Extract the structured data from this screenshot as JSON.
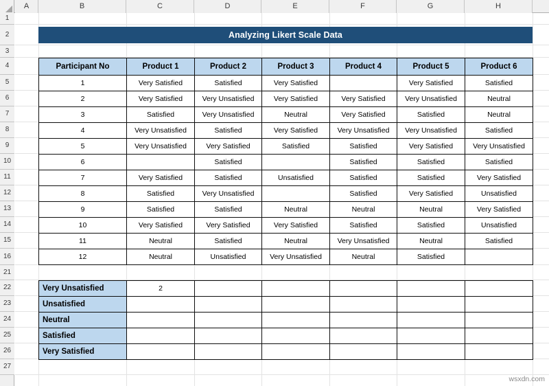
{
  "app": {
    "type": "spreadsheet",
    "watermark": "wsxdn.com"
  },
  "colors": {
    "title_banner_bg": "#1F4E79",
    "title_banner_text": "#FFFFFF",
    "header_bg": "#BDD7EE",
    "label_bg": "#BDD7EE",
    "cell_border": "#0D0D0D",
    "gridline": "#E3E3E3",
    "sheet_chrome": "#F0F0F0"
  },
  "column_headers": [
    "A",
    "B",
    "C",
    "D",
    "E",
    "F",
    "G",
    "H"
  ],
  "row_headers": [
    "1",
    "2",
    "3",
    "4",
    "5",
    "6",
    "7",
    "8",
    "9",
    "10",
    "11",
    "12",
    "13",
    "14",
    "15",
    "16",
    "21",
    "22",
    "23",
    "24",
    "25",
    "26",
    "27"
  ],
  "title": {
    "text": "Analyzing Likert Scale Data"
  },
  "main_table": {
    "headers": [
      "Participant No",
      "Product 1",
      "Product 2",
      "Product 3",
      "Product 4",
      "Product 5",
      "Product 6"
    ],
    "rows": [
      [
        "1",
        "Very Satisfied",
        "Satisfied",
        "Very Satisfied",
        "",
        "Very Satisfied",
        "Satisfied"
      ],
      [
        "2",
        "Very Satisfied",
        "Very Unsatisfied",
        "Very Satisfied",
        "Very Satisfied",
        "Very Unsatisfied",
        "Neutral"
      ],
      [
        "3",
        "Satisfied",
        "Very Unsatisfied",
        "Neutral",
        "Very Satisfied",
        "Satisfied",
        "Neutral"
      ],
      [
        "4",
        "Very Unsatisfied",
        "Satisfied",
        "Very Satisfied",
        "Very Unsatisfied",
        "Very Unsatisfied",
        "Satisfied"
      ],
      [
        "5",
        "Very Unsatisfied",
        "Very Satisfied",
        "Satisfied",
        "Satisfied",
        "Very Satisfied",
        "Very Unsatisfied"
      ],
      [
        "6",
        "",
        "Satisfied",
        "",
        "Satisfied",
        "Satisfied",
        "Satisfied"
      ],
      [
        "7",
        "Very Satisfied",
        "Satisfied",
        "Unsatisfied",
        "Satisfied",
        "Satisfied",
        "Very Satisfied"
      ],
      [
        "8",
        "Satisfied",
        "Very Unsatisfied",
        "",
        "Satisfied",
        "Very Satisfied",
        "Unsatisfied"
      ],
      [
        "9",
        "Satisfied",
        "Satisfied",
        "Neutral",
        "Neutral",
        "Neutral",
        "Very Satisfied"
      ],
      [
        "10",
        "Very Satisfied",
        "Very Satisfied",
        "Very Satisfied",
        "Satisfied",
        "Satisfied",
        "Unsatisfied"
      ],
      [
        "11",
        "Neutral",
        "Satisfied",
        "Neutral",
        "Very Unsatisfied",
        "Neutral",
        "Satisfied"
      ],
      [
        "12",
        "Neutral",
        "Unsatisfied",
        "Very Unsatisfied",
        "Neutral",
        "Satisfied",
        ""
      ]
    ]
  },
  "summary_table": {
    "rows": [
      {
        "label": "Very Unsatisfied",
        "values": [
          "2",
          "",
          "",
          "",
          "",
          ""
        ]
      },
      {
        "label": "Unsatisfied",
        "values": [
          "",
          "",
          "",
          "",
          "",
          ""
        ]
      },
      {
        "label": "Neutral",
        "values": [
          "",
          "",
          "",
          "",
          "",
          ""
        ]
      },
      {
        "label": "Satisfied",
        "values": [
          "",
          "",
          "",
          "",
          "",
          ""
        ]
      },
      {
        "label": "Very Satisfied",
        "values": [
          "",
          "",
          "",
          "",
          "",
          ""
        ]
      }
    ]
  }
}
